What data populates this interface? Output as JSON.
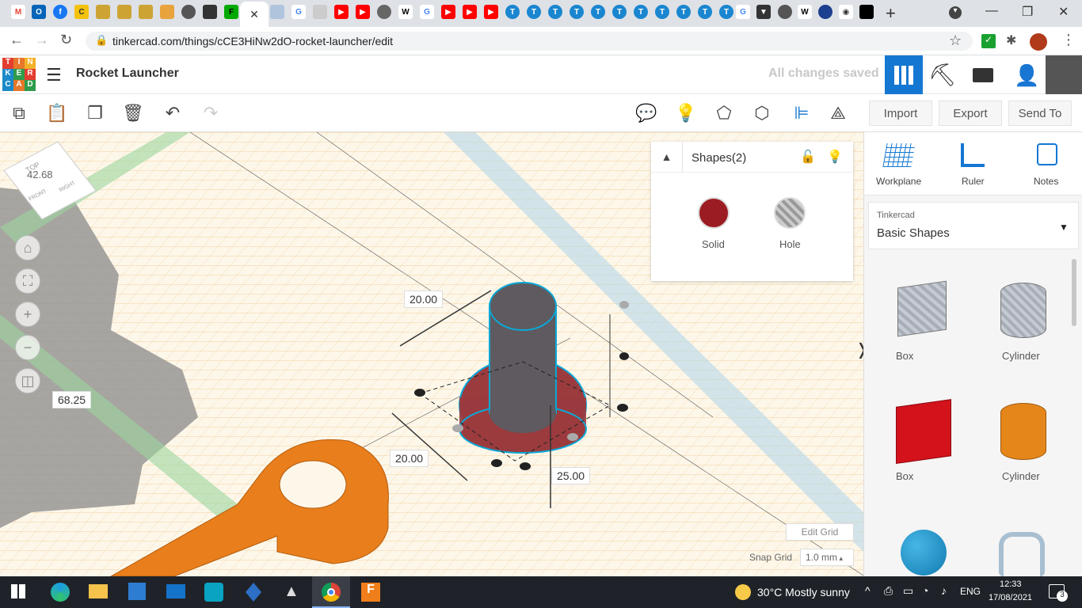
{
  "browser": {
    "url": "tinkercad.com/things/cCE3HiNw2dO-rocket-launcher/edit",
    "new_tab": "+"
  },
  "app": {
    "logo": [
      "T",
      "I",
      "N",
      "K",
      "E",
      "R",
      "C",
      "A",
      "D"
    ],
    "title": "Rocket Launcher",
    "save_status": "All changes saved"
  },
  "toolbar": {
    "import": "Import",
    "export": "Export",
    "send_to": "Send To"
  },
  "viewcube": {
    "value": "42.68",
    "top": "TOP",
    "front": "FRONT",
    "right": "RIGHT"
  },
  "dimensions": {
    "d1": "20.00",
    "d2": "20.00",
    "d3": "25.00",
    "d4": "68.25"
  },
  "shapes_panel": {
    "title": "Shapes(2)",
    "solid": "Solid",
    "hole": "Hole",
    "solid_color": "#9b1c22"
  },
  "grid": {
    "edit_grid": "Edit Grid",
    "snap_label": "Snap Grid",
    "snap_value": "1.0 mm"
  },
  "rightpanel": {
    "workplane": "Workplane",
    "ruler": "Ruler",
    "notes": "Notes",
    "lib_source": "Tinkercad",
    "lib_name": "Basic Shapes",
    "shapes": [
      {
        "label": "Box"
      },
      {
        "label": "Cylinder"
      },
      {
        "label": "Box"
      },
      {
        "label": "Cylinder"
      }
    ]
  },
  "taskbar": {
    "weather": "30°C  Mostly sunny",
    "lang": "ENG",
    "time": "12:33",
    "date": "17/08/2021",
    "notif": "3"
  },
  "colors": {
    "accent": "#1477d2",
    "orange": "#e97e1c",
    "red": "#c8161d",
    "grid_bg": "#fdf7ea"
  }
}
